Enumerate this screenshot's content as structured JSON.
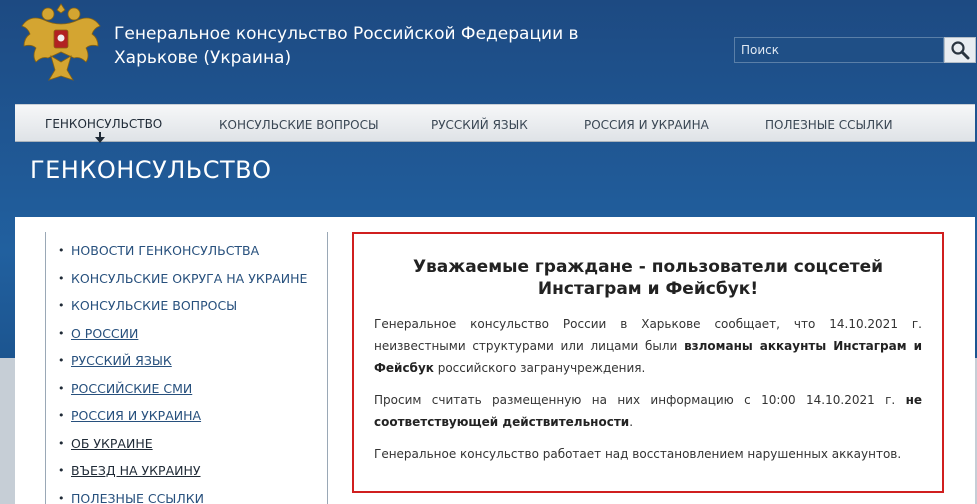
{
  "header": {
    "site_title": "Генеральное консульство Российской Федерации в Харькове (Украина)",
    "search_placeholder": "Поиск"
  },
  "nav": {
    "items": [
      {
        "label": "ГЕНКОНСУЛЬСТВО",
        "active": true
      },
      {
        "label": "КОНСУЛЬСКИЕ ВОПРОСЫ"
      },
      {
        "label": "РУССКИЙ ЯЗЫК"
      },
      {
        "label": "РОССИЯ И УКРАИНА"
      },
      {
        "label": "ПОЛЕЗНЫЕ ССЫЛКИ"
      }
    ]
  },
  "page": {
    "heading": "ГЕНКОНСУЛЬСТВО"
  },
  "sidebar": {
    "items": [
      {
        "label": "НОВОСТИ ГЕНКОНСУЛЬСТВА"
      },
      {
        "label": "КОНСУЛЬСКИЕ ОКРУГА НА УКРАИНЕ"
      },
      {
        "label": "КОНСУЛЬСКИЕ ВОПРОСЫ"
      },
      {
        "label": "О РОССИИ"
      },
      {
        "label": "РУССКИЙ ЯЗЫК"
      },
      {
        "label": "РОССИЙСКИЕ СМИ"
      },
      {
        "label": "РОССИЯ И УКРАИНА"
      },
      {
        "label": "ОБ УКРАИНЕ"
      },
      {
        "label": "ВЪЕЗД НА УКРАИНУ"
      },
      {
        "label": "ПОЛЕЗНЫЕ ССЫЛКИ"
      }
    ]
  },
  "notice": {
    "title": "Уважаемые граждане - пользователи соцсетей Инстаграм и Фейсбук!",
    "p1_start": "Генеральное консульство России в Харькове сообщает, что 14.10.2021 г. неизвестными структурами или лицами были ",
    "p1_bold": "взломаны аккаунты Инстаграм и Фейсбук",
    "p1_end": " российского загранучреждения.",
    "p2_start": "Просим считать размещенную на них информацию с 10:00 14.10.2021 г. ",
    "p2_bold": "не соответствующей действительности",
    "p2_end": ".",
    "p3": "Генеральное консульство работает над восстановлением нарушенных аккаунтов."
  },
  "colors": {
    "header_blue": "#1f5591",
    "notice_border": "#d01f1f",
    "link": "#27507d"
  }
}
